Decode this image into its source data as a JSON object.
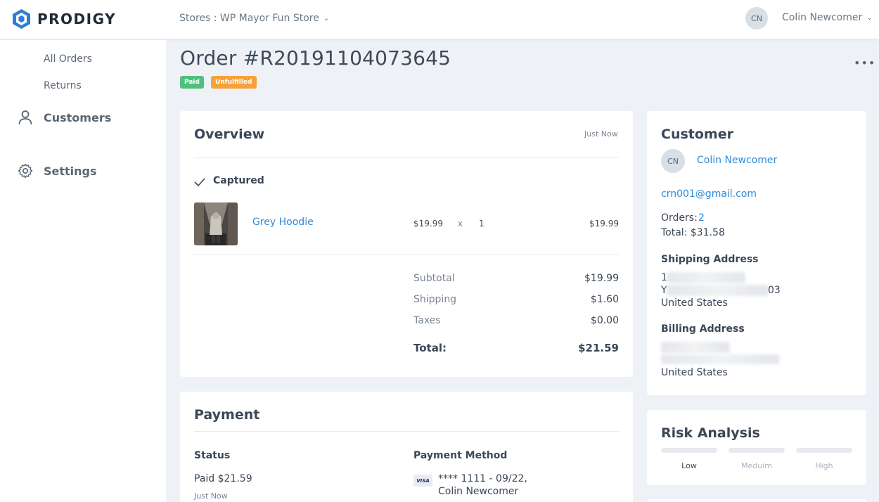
{
  "header": {
    "brand": "PRODIGY",
    "store_selector": "Stores : WP Mayor Fun Store",
    "user_initials": "CN",
    "user_name": "Colin Newcomer"
  },
  "sidebar": {
    "sub_items": [
      "All Orders",
      "Returns"
    ],
    "items": [
      {
        "label": "Customers",
        "icon": "user-icon"
      },
      {
        "label": "Settings",
        "icon": "gear-icon"
      }
    ]
  },
  "order": {
    "title": "Order #R20191104073645",
    "badges": {
      "paid": "Paid",
      "fulfillment": "Unfulfilled"
    },
    "more": "•••"
  },
  "overview": {
    "title": "Overview",
    "time": "Just Now",
    "status": "Captured",
    "item": {
      "name": "Grey Hoodie",
      "price": "$19.99",
      "times": "x",
      "qty": "1",
      "line_total": "$19.99"
    },
    "totals": {
      "subtotal_label": "Subtotal",
      "subtotal": "$19.99",
      "shipping_label": "Shipping",
      "shipping": "$1.60",
      "taxes_label": "Taxes",
      "taxes": "$0.00",
      "total_label": "Total:",
      "total": "$21.59"
    }
  },
  "payment": {
    "title": "Payment",
    "status_header": "Status",
    "status_value": "Paid $21.59",
    "status_time": "Just Now",
    "method_header": "Payment Method",
    "card_brand": "VISA",
    "card_text": "**** 1111 - 09/22,",
    "card_holder": "Colin Newcomer"
  },
  "customer": {
    "title": "Customer",
    "initials": "CN",
    "name": "Colin Newcomer",
    "email": "crn001@gmail.com",
    "orders_label": "Orders:",
    "orders_count": "2",
    "total": "Total: $31.58",
    "shipping_header": "Shipping Address",
    "shipping_line1_fragment": "1",
    "shipping_line2_start": "Y",
    "shipping_line2_end": "03",
    "shipping_country": "United States",
    "billing_header": "Billing Address",
    "billing_country": "United States"
  },
  "risk": {
    "title": "Risk Analysis",
    "levels": [
      "Low",
      "Meduim",
      "High"
    ],
    "colors": {
      "active": "#3b4757",
      "inactive": "#a9b2bd"
    }
  },
  "colors": {
    "accent": "#2e8bd8",
    "paid": "#4fc07d",
    "unfulfilled": "#f7a13b",
    "background": "#eef2f6"
  }
}
